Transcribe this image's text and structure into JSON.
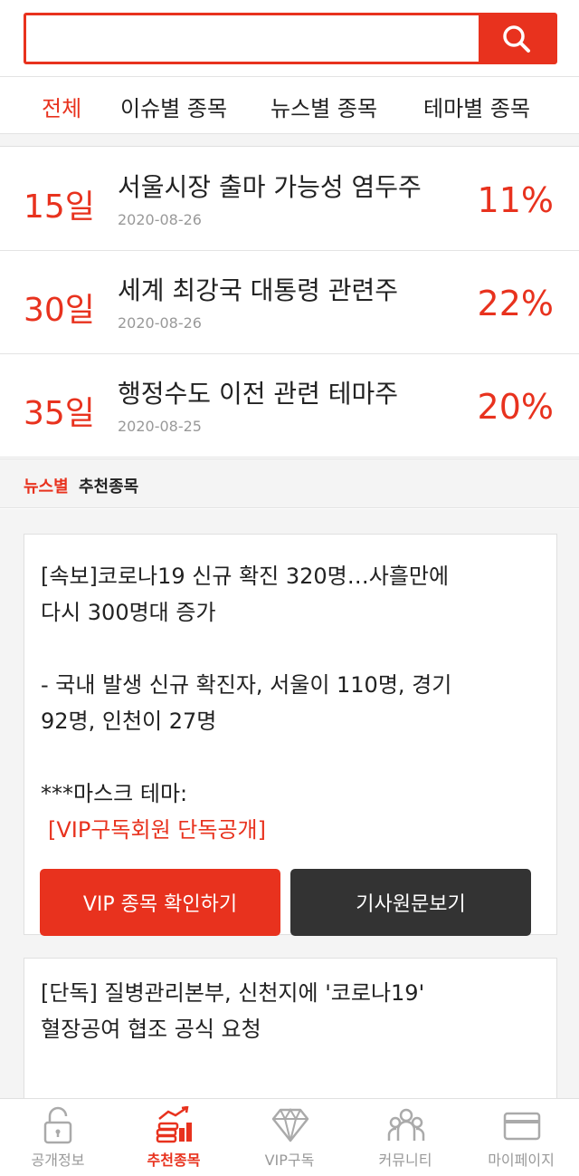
{
  "search": {
    "value": "",
    "placeholder": ""
  },
  "tabs": [
    {
      "label": "전체",
      "active": true
    },
    {
      "label": "이슈별 종목",
      "active": false
    },
    {
      "label": "뉴스별 종목",
      "active": false
    },
    {
      "label": "테마별 종목",
      "active": false
    }
  ],
  "themes": [
    {
      "day": "15일",
      "title": "서울시장 출마 가능성 염두주",
      "date": "2020-08-26",
      "pct": "11%"
    },
    {
      "day": "30일",
      "title": "세계 최강국 대통령 관련주",
      "date": "2020-08-26",
      "pct": "22%"
    },
    {
      "day": "35일",
      "title": "행정수도 이전 관련 테마주",
      "date": "2020-08-25",
      "pct": "20%"
    }
  ],
  "section": {
    "red": "뉴스별",
    "dark": "추천종목"
  },
  "news": [
    {
      "text": "[속보]코로나19 신규 확진 320명…사흘만에\n다시 300명대 증가\n\n- 국내 발생 신규 확진자, 서울이 110명, 경기\n92명, 인천이 27명\n\n***마스크 테마:",
      "vip_note": "[VIP구독회원 단독공개]",
      "vip_button": "VIP 종목 확인하기",
      "article_button": "기사원문보기"
    },
    {
      "text": "[단독] 질병관리본부, 신천지에 '코로나19'\n혈장공여 협조 공식 요청"
    }
  ],
  "bottom_nav": [
    {
      "label": "공개정보",
      "icon": "lock-icon",
      "active": false
    },
    {
      "label": "추천종목",
      "icon": "coins-chart-icon",
      "active": true
    },
    {
      "label": "VIP구독",
      "icon": "diamond-icon",
      "active": false
    },
    {
      "label": "커뮤니티",
      "icon": "community-icon",
      "active": false
    },
    {
      "label": "마이페이지",
      "icon": "card-icon",
      "active": false
    }
  ],
  "colors": {
    "accent": "#e8321e",
    "dark_button": "#333333",
    "muted": "#999999"
  }
}
